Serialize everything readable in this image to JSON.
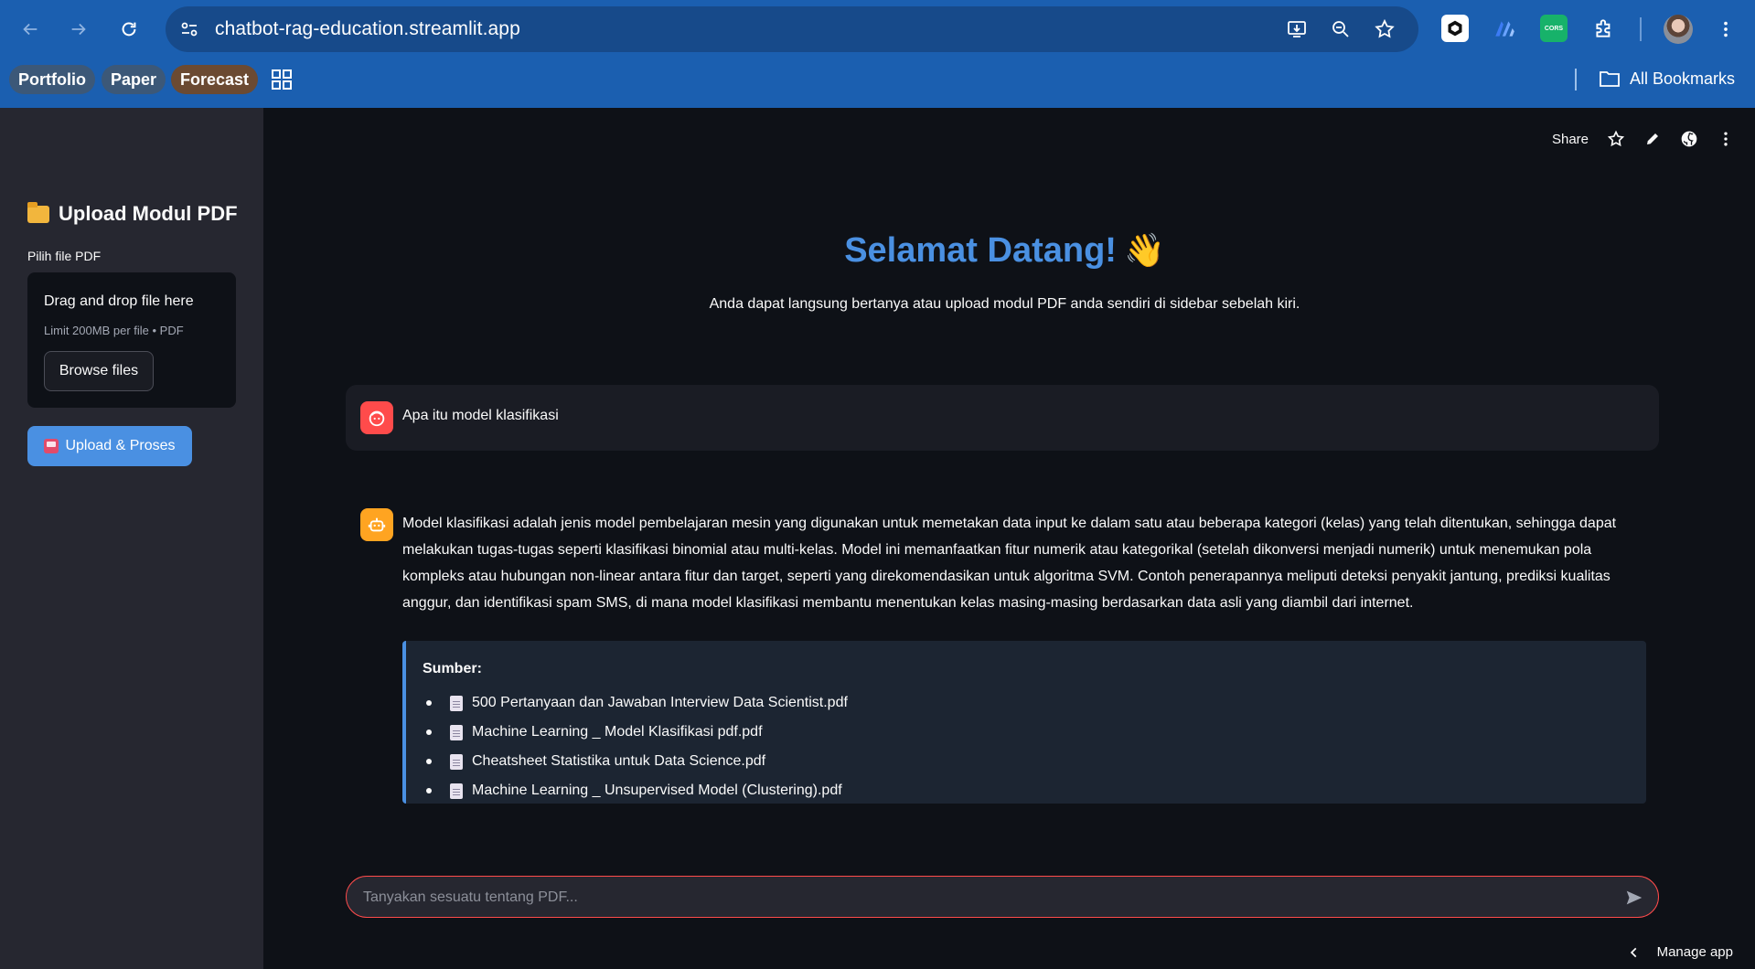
{
  "browser": {
    "url": "chatbot-rag-education.streamlit.app",
    "bookmarks": [
      "Portfolio",
      "Paper",
      "Forecast"
    ],
    "all_bookmarks_label": "All Bookmarks",
    "extensions": [
      "cursor-icon",
      "streamlit-icon",
      "cors-icon",
      "puzzle-icon"
    ],
    "colors": {
      "chrome": "#1b5fb0",
      "omnibox": "#174a8a"
    }
  },
  "sidebar": {
    "title": "Upload Modul PDF",
    "file_label": "Pilih file PDF",
    "dropzone_title": "Drag and drop file here",
    "dropzone_limit": "Limit 200MB per file • PDF",
    "browse_label": "Browse files",
    "upload_label": "Upload & Proses"
  },
  "topbar": {
    "share_label": "Share"
  },
  "main": {
    "welcome": "Selamat Datang!",
    "welcome_emoji": "👋",
    "subtitle": "Anda dapat langsung bertanya atau upload modul PDF anda sendiri di sidebar sebelah kiri.",
    "user_message": "Apa itu model klasifikasi",
    "bot_message": "Model klasifikasi adalah jenis model pembelajaran mesin yang digunakan untuk memetakan data input ke dalam satu atau beberapa kategori (kelas) yang telah ditentukan, sehingga dapat melakukan tugas-tugas seperti klasifikasi binomial atau multi-kelas. Model ini memanfaatkan fitur numerik atau kategorikal (setelah dikonversi menjadi numerik) untuk menemukan pola kompleks atau hubungan non-linear antara fitur dan target, seperti yang direkomendasikan untuk algoritma SVM. Contoh penerapannya meliputi deteksi penyakit jantung, prediksi kualitas anggur, dan identifikasi spam SMS, di mana model klasifikasi membantu menentukan kelas masing-masing berdasarkan data asli yang diambil dari internet.",
    "sources_title": "Sumber:",
    "sources": [
      "500 Pertanyaan dan Jawaban Interview Data Scientist.pdf",
      "Machine Learning _ Model Klasifikasi pdf.pdf",
      "Cheatsheet Statistika untuk Data Science.pdf",
      "Machine Learning _ Unsupervised Model (Clustering).pdf"
    ],
    "chat_placeholder": "Tanyakan sesuatu tentang PDF...",
    "manage_label": "Manage app"
  },
  "colors": {
    "accent": "#4a90e2",
    "user_avatar": "#ff4b4b",
    "bot_avatar": "#ffa421",
    "background": "#0e1117",
    "sidebar": "#262730"
  }
}
